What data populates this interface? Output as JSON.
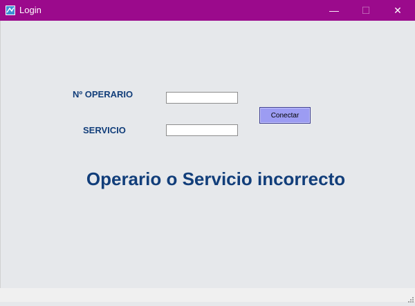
{
  "window": {
    "title": "Login",
    "controls": {
      "minimize": "—",
      "maximize": "☐",
      "close": "✕"
    }
  },
  "form": {
    "operario_label": "Nº OPERARIO",
    "operario_value": "",
    "servicio_label": "SERVICIO",
    "servicio_value": "",
    "connect_label": "Conectar"
  },
  "message": {
    "error_text": "Operario o Servicio incorrecto"
  },
  "icons": {
    "app": "app-icon",
    "grip": "resize-grip-icon"
  },
  "colors": {
    "titlebar": "#9b0a8c",
    "label_text": "#123e7a",
    "button": "#9c9cf2",
    "background": "#e6e8eb"
  }
}
